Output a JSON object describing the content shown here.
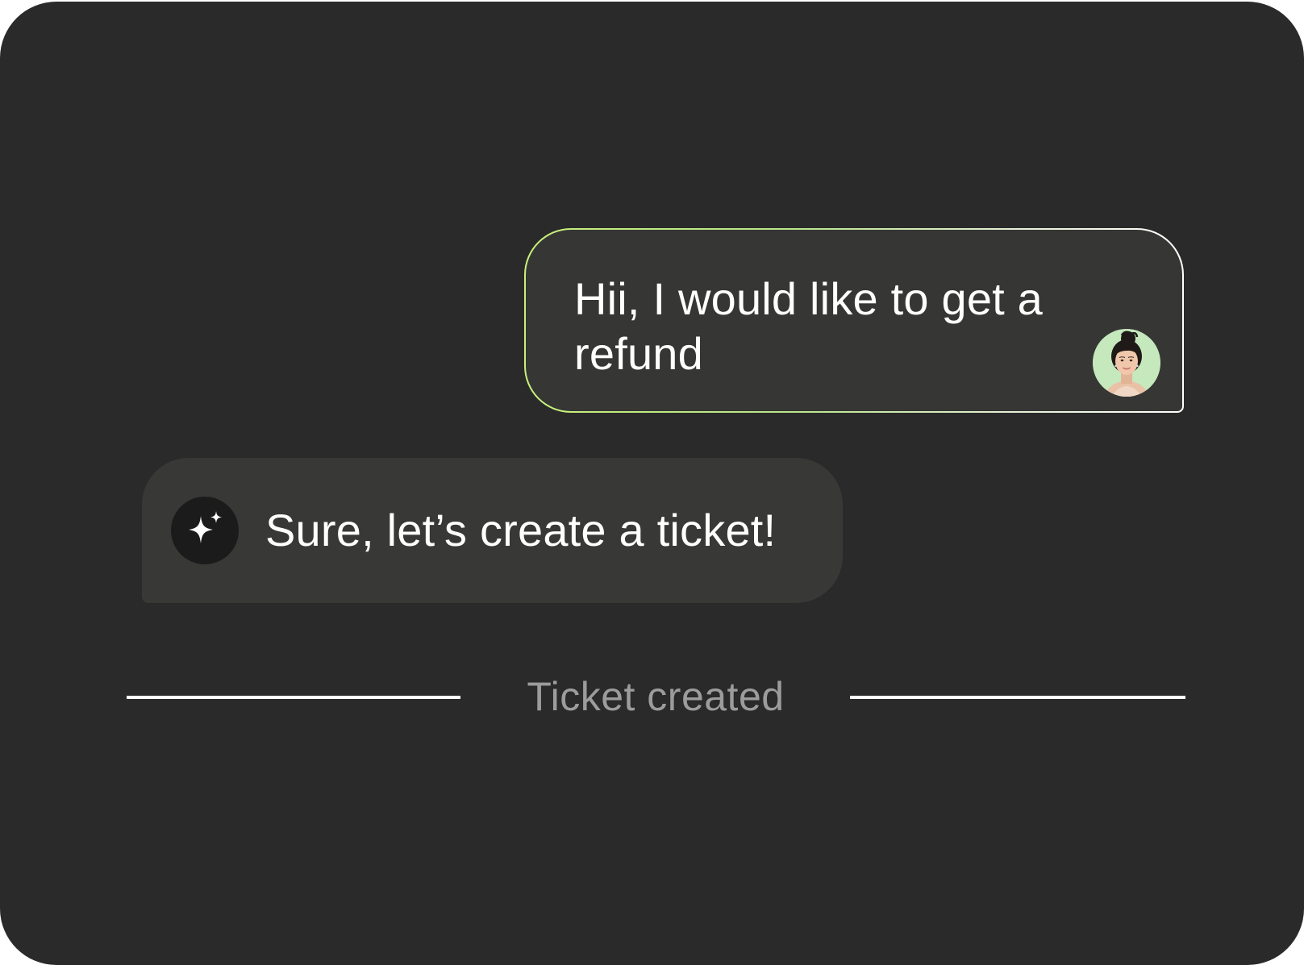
{
  "colors": {
    "background": "#2a2a2a",
    "bubble": "#363634",
    "accent_gradient_start": "#c8f07a",
    "accent_gradient_end": "#ffffff",
    "muted_text": "#9c9c9c"
  },
  "conversation": {
    "user_message": {
      "text": "Hii, I would like to get a refund",
      "avatar_icon": "user-avatar"
    },
    "bot_message": {
      "text": "Sure, let’s create a ticket!",
      "icon": "sparkle-icon"
    },
    "divider": {
      "label": "Ticket created"
    }
  }
}
